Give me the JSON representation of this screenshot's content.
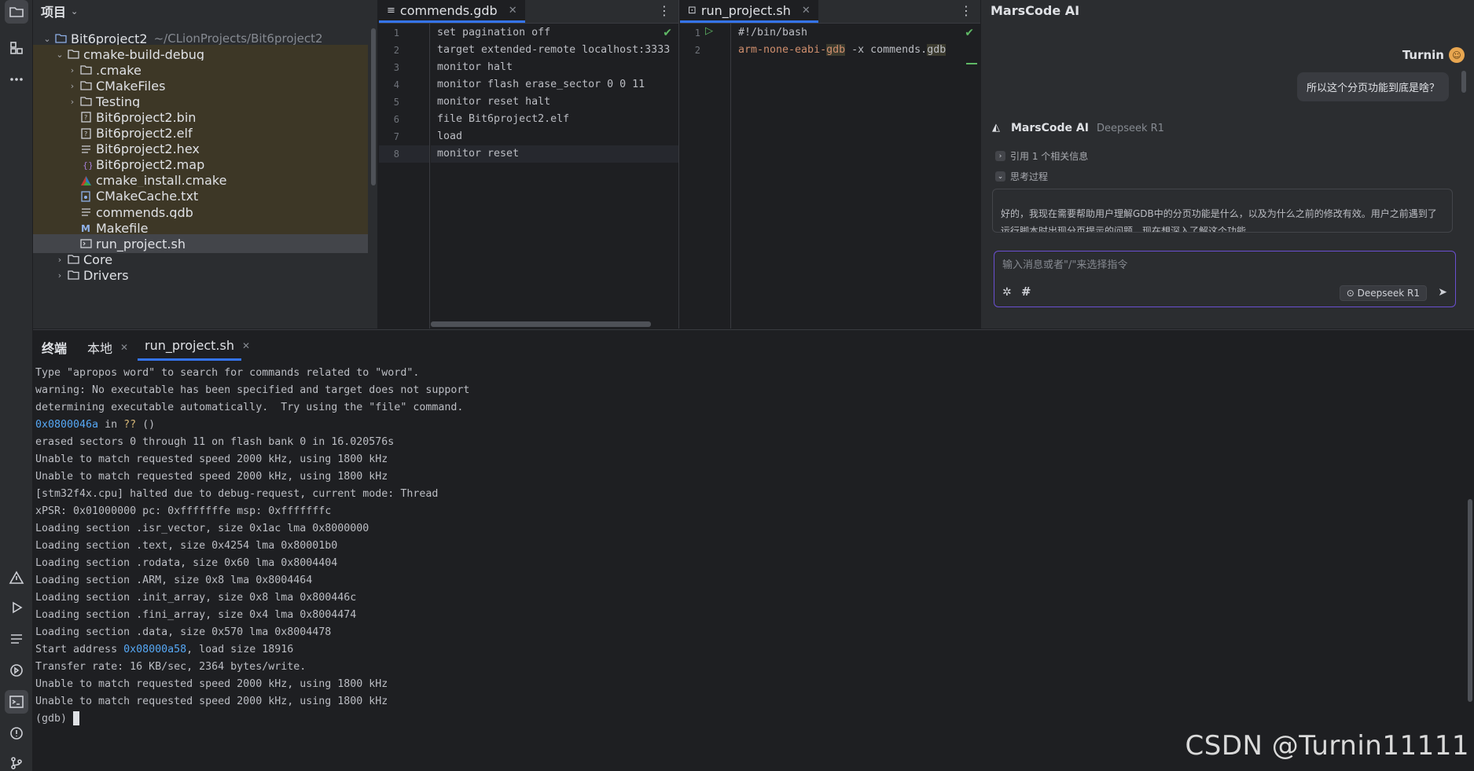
{
  "project": {
    "title": "项目",
    "root_name": "Bit6project2",
    "root_path": "~/CLionProjects/Bit6project2",
    "tree": [
      {
        "label": "cmake-build-debug",
        "type": "folder",
        "open": true,
        "depth": 1
      },
      {
        "label": ".cmake",
        "type": "folder",
        "open": false,
        "depth": 2
      },
      {
        "label": "CMakeFiles",
        "type": "folder",
        "open": false,
        "depth": 2
      },
      {
        "label": "Testing",
        "type": "folder",
        "open": false,
        "depth": 2
      },
      {
        "label": "Bit6project2.bin",
        "type": "binary",
        "depth": 2
      },
      {
        "label": "Bit6project2.elf",
        "type": "binary",
        "depth": 2
      },
      {
        "label": "Bit6project2.hex",
        "type": "text",
        "depth": 2
      },
      {
        "label": "Bit6project2.map",
        "type": "map",
        "depth": 2
      },
      {
        "label": "cmake_install.cmake",
        "type": "cmake",
        "depth": 2
      },
      {
        "label": "CMakeCache.txt",
        "type": "cache",
        "depth": 2
      },
      {
        "label": "commends.gdb",
        "type": "text",
        "depth": 2
      },
      {
        "label": "Makefile",
        "type": "makefile",
        "depth": 2
      },
      {
        "label": "run_project.sh",
        "type": "shell",
        "depth": 2,
        "selected": true
      },
      {
        "label": "Core",
        "type": "folder",
        "open": false,
        "depth": 1
      },
      {
        "label": "Drivers",
        "type": "folder",
        "open": false,
        "depth": 1
      }
    ]
  },
  "editor1": {
    "tab_label": "commends.gdb",
    "lines": [
      "set pagination off",
      "target extended-remote localhost:3333",
      "monitor halt",
      "monitor flash erase_sector 0 0 11",
      "monitor reset halt",
      "file Bit6project2.elf",
      "load",
      "monitor reset"
    ],
    "current_line": 8
  },
  "editor2": {
    "tab_label": "run_project.sh",
    "line1": "#!/bin/bash",
    "line2_part1": "arm-none-eabi-",
    "line2_part2": "gdb",
    "line2_part3": " -x commends.",
    "line2_part4": "gdb"
  },
  "ai": {
    "title": "MarsCode AI",
    "user_name": "Turnin",
    "user_message": "所以这个分页功能到底是啥？",
    "bot_name": "MarsCode AI",
    "bot_model": "Deepseek R1",
    "ref_label": "引用 1 个相关信息",
    "think_label": "思考过程",
    "think_text": "好的，我现在需要帮助用户理解GDB中的分页功能是什么，以及为什么之前的修改有效。用户之前遇到了运行脚本时出现分页提示的问题，现在想深入了解这个功能。",
    "input_placeholder": "输入消息或者\"/\"来选择指令",
    "model_pill": "Deepseek R1"
  },
  "terminal": {
    "tab_title": "终端",
    "tab_local": "本地",
    "tab_run": "run_project.sh",
    "lines": [
      {
        "text": "Type \"apropos word\" to search for commands related to \"word\"."
      },
      {
        "text": "warning: No executable has been specified and target does not support"
      },
      {
        "text": "determining executable automatically.  Try using the \"file\" command."
      },
      {
        "addr": "0x0800046a",
        "mid": " in ",
        "q": "??",
        "rest": " ()"
      },
      {
        "text": "erased sectors 0 through 11 on flash bank 0 in 16.020576s"
      },
      {
        "text": "Unable to match requested speed 2000 kHz, using 1800 kHz"
      },
      {
        "text": "Unable to match requested speed 2000 kHz, using 1800 kHz"
      },
      {
        "text": "[stm32f4x.cpu] halted due to debug-request, current mode: Thread"
      },
      {
        "text": "xPSR: 0x01000000 pc: 0xfffffffe msp: 0xfffffffc"
      },
      {
        "text": "Loading section .isr_vector, size 0x1ac lma 0x8000000"
      },
      {
        "text": "Loading section .text, size 0x4254 lma 0x80001b0"
      },
      {
        "text": "Loading section .rodata, size 0x60 lma 0x8004404"
      },
      {
        "text": "Loading section .ARM, size 0x8 lma 0x8004464"
      },
      {
        "text": "Loading section .init_array, size 0x8 lma 0x800446c"
      },
      {
        "text": "Loading section .fini_array, size 0x4 lma 0x8004474"
      },
      {
        "text": "Loading section .data, size 0x570 lma 0x8004478"
      },
      {
        "pre": "Start address ",
        "addr": "0x08000a58",
        "rest": ", load size 18916"
      },
      {
        "text": "Transfer rate: 16 KB/sec, 2364 bytes/write."
      },
      {
        "text": "Unable to match requested speed 2000 kHz, using 1800 kHz"
      },
      {
        "text": "Unable to match requested speed 2000 kHz, using 1800 kHz"
      },
      {
        "text": "(gdb) "
      }
    ]
  },
  "watermark": "CSDN @Turnin11111"
}
